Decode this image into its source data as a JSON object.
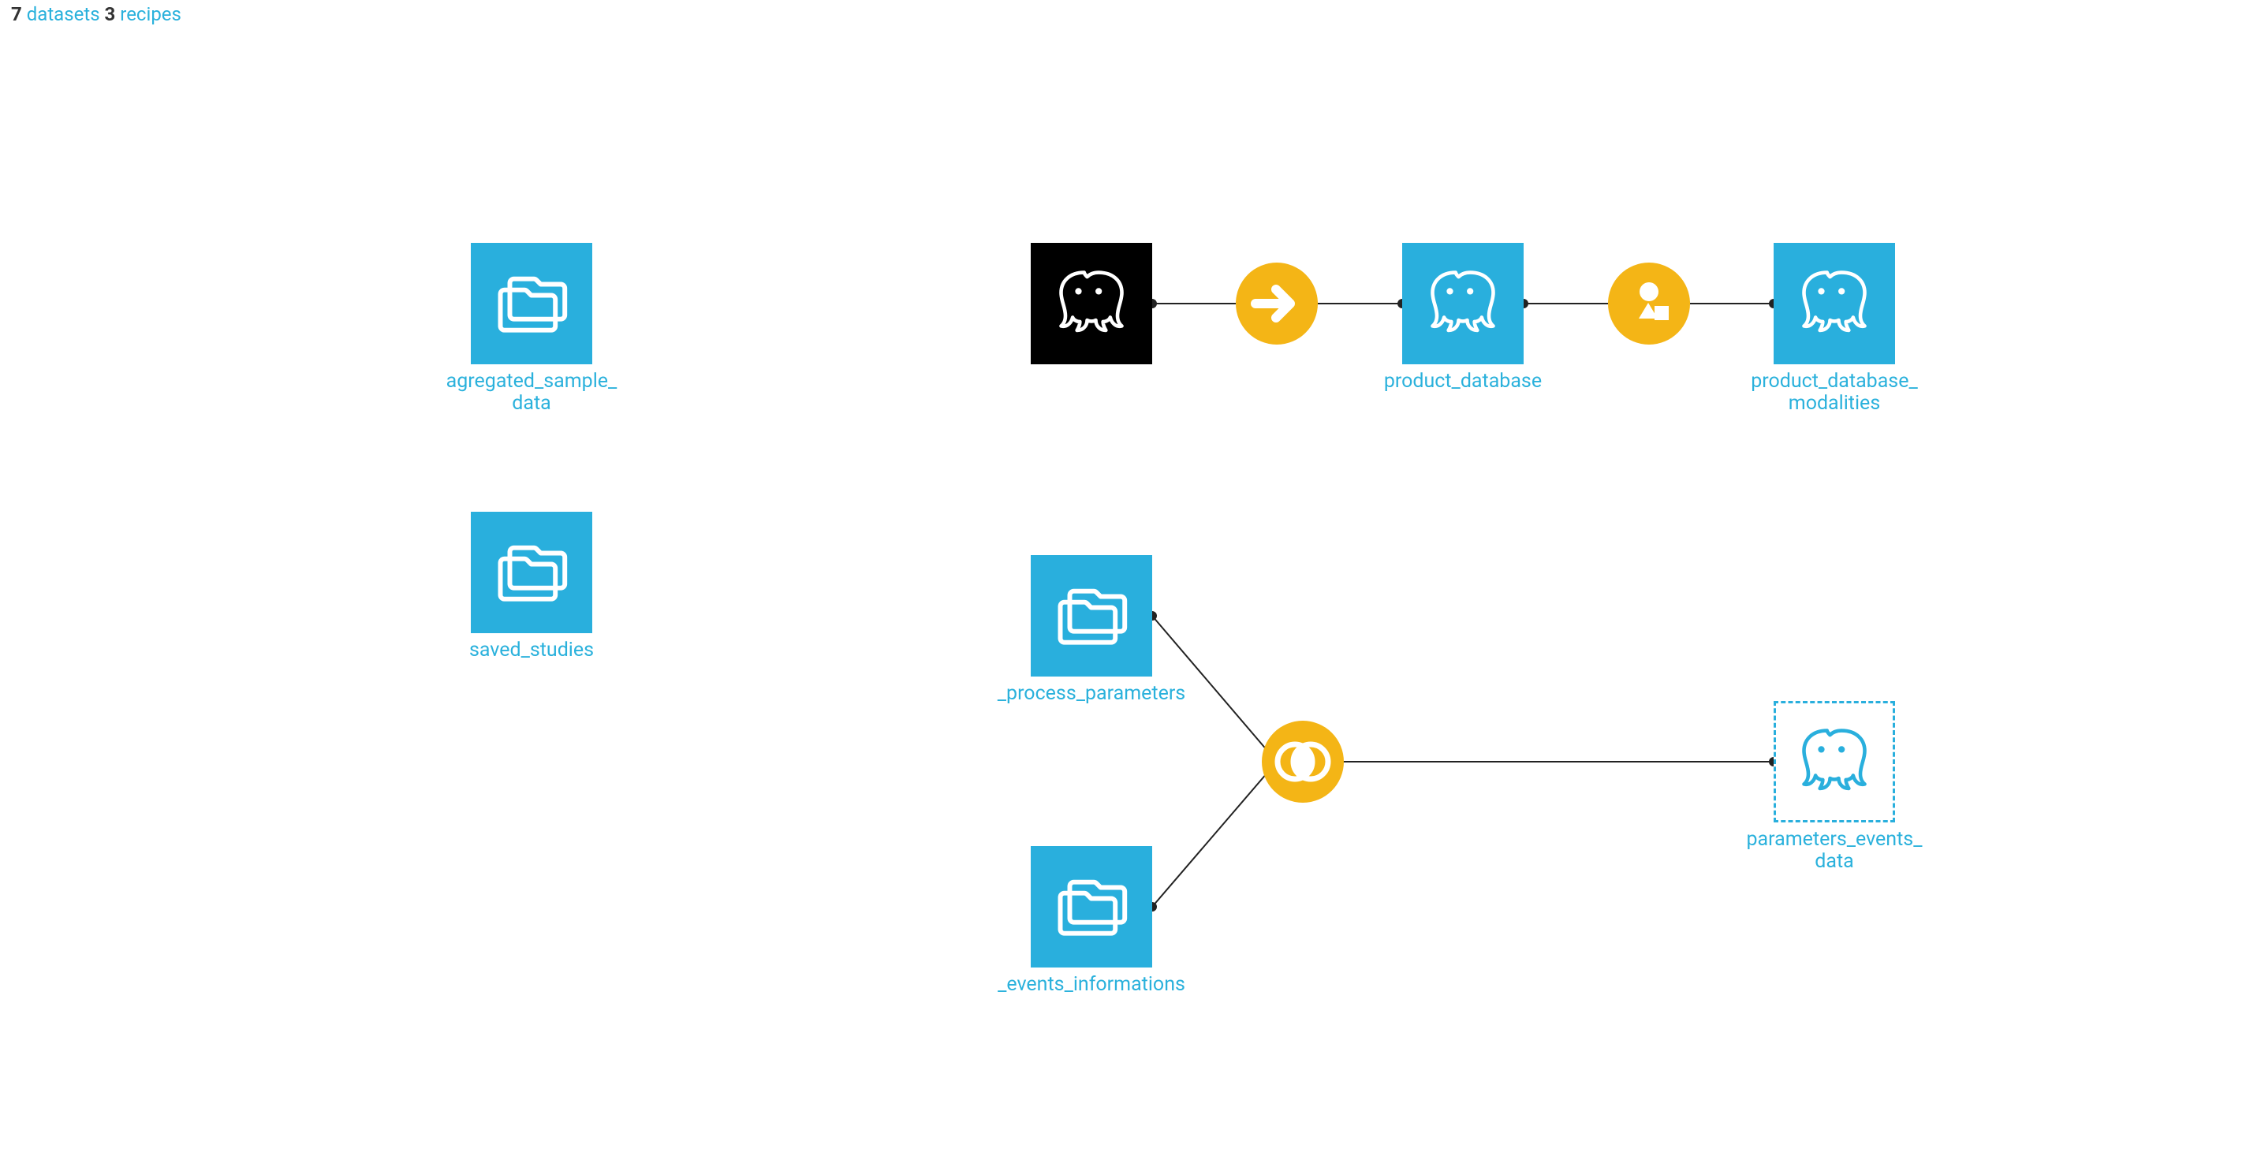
{
  "legend": {
    "datasets_count": "7",
    "datasets_label": "datasets",
    "recipes_count": "3",
    "recipes_label": "recipes"
  },
  "nodes": {
    "agregated_sample_data": {
      "label": "agregated_sample_\ndata"
    },
    "saved_studies": {
      "label": "saved_studies"
    },
    "product_database_src": {
      "label": ""
    },
    "product_database": {
      "label": "product_database"
    },
    "product_database_modalities": {
      "label": "product_database_\nmodalities"
    },
    "process_parameters": {
      "label": "_process_parameters"
    },
    "events_informations": {
      "label": "_events_informations"
    },
    "parameters_events_data": {
      "label": "parameters_events_\ndata"
    }
  },
  "recipes": {
    "sync": {
      "name": "sync"
    },
    "prepare": {
      "name": "prepare"
    },
    "join": {
      "name": "join"
    }
  }
}
